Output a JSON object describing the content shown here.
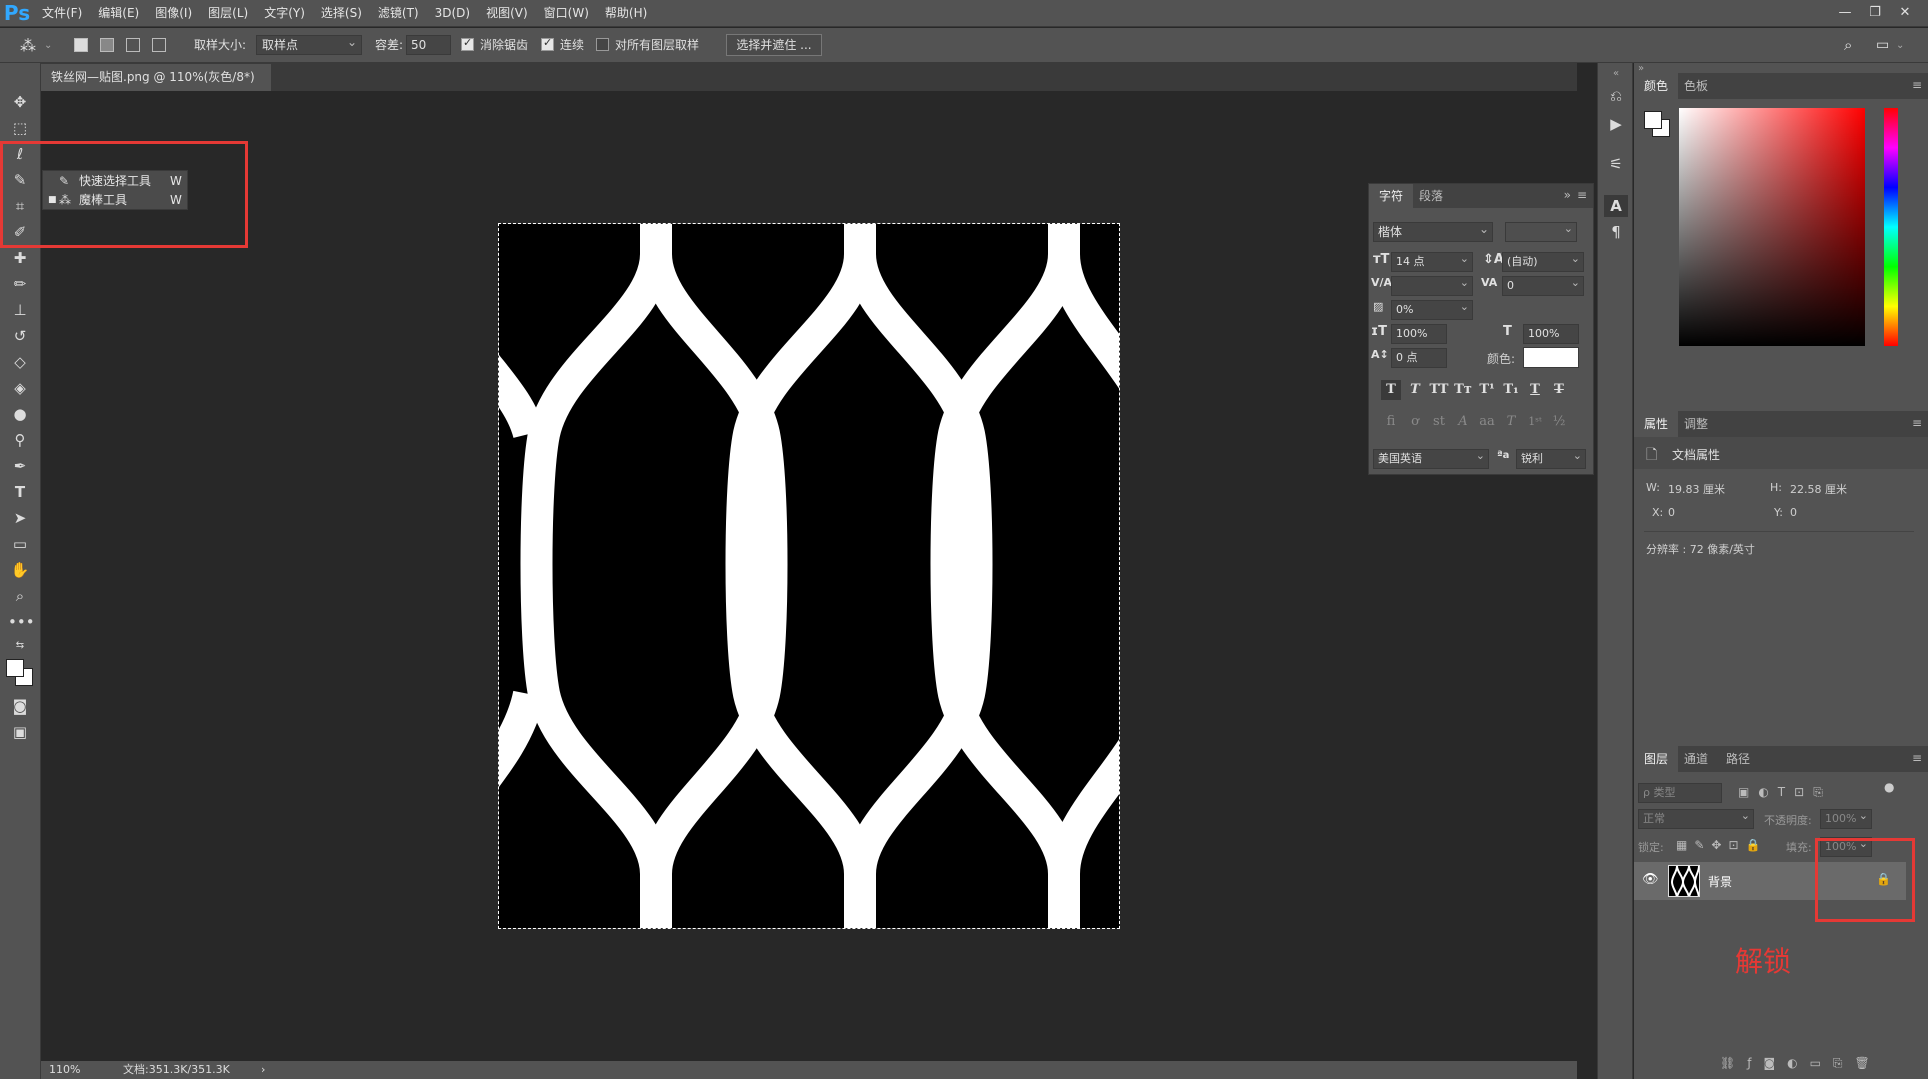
{
  "app": {
    "logo": "Ps"
  },
  "menubar": {
    "items": [
      "文件(F)",
      "编辑(E)",
      "图像(I)",
      "图层(L)",
      "文字(Y)",
      "选择(S)",
      "滤镜(T)",
      "3D(D)",
      "视图(V)",
      "窗口(W)",
      "帮助(H)"
    ],
    "minimize": "—",
    "restore": "❐",
    "close": "✕"
  },
  "options": {
    "sample_size_label": "取样大小:",
    "sample_size_value": "取样点",
    "tolerance_label": "容差:",
    "tolerance_value": "50",
    "antialias_label": "消除锯齿",
    "contiguous_label": "连续",
    "sample_all_label": "对所有图层取样",
    "select_mask_button": "选择并遮住 ..."
  },
  "document": {
    "tab_title": "铁丝网—贴图.png @ 110%(灰色/8*)",
    "close": "×"
  },
  "status": {
    "zoom": "110%",
    "doc_size": "文档:351.3K/351.3K",
    "arrow": "›"
  },
  "flyout": {
    "items": [
      {
        "label": "快速选择工具",
        "shortcut": "W",
        "active": false
      },
      {
        "label": "魔棒工具",
        "shortcut": "W",
        "active": true
      }
    ]
  },
  "annotation": {
    "unlock": "解锁"
  },
  "color_panel": {
    "tabs": [
      "颜色",
      "色板"
    ]
  },
  "properties_panel": {
    "tabs": [
      "属性",
      "调整"
    ],
    "section": "文档属性",
    "w_label": "W:",
    "w_value": "19.83 厘米",
    "h_label": "H:",
    "h_value": "22.58 厘米",
    "x_label": "X:",
    "x_value": "0",
    "y_label": "Y:",
    "y_value": "0",
    "resolution": "分辨率 : 72 像素/英寸"
  },
  "character_panel": {
    "tabs": [
      "字符",
      "段落"
    ],
    "font_family": "楷体",
    "font_size": "14 点",
    "leading": "(自动)",
    "kerning": "",
    "tracking": "0",
    "tsume": "0%",
    "vscale": "100%",
    "hscale": "100%",
    "baseline": "0 点",
    "color_label": "颜色:",
    "language": "美国英语",
    "antialias": "锐利"
  },
  "layers_panel": {
    "tabs": [
      "图层",
      "通道",
      "路径"
    ],
    "filter_placeholder": "ρ 类型",
    "blend_mode": "正常",
    "opacity_label": "不透明度:",
    "opacity_value": "100%",
    "lock_label": "锁定:",
    "fill_label": "填充:",
    "fill_value": "100%",
    "layer_name": "背景"
  }
}
